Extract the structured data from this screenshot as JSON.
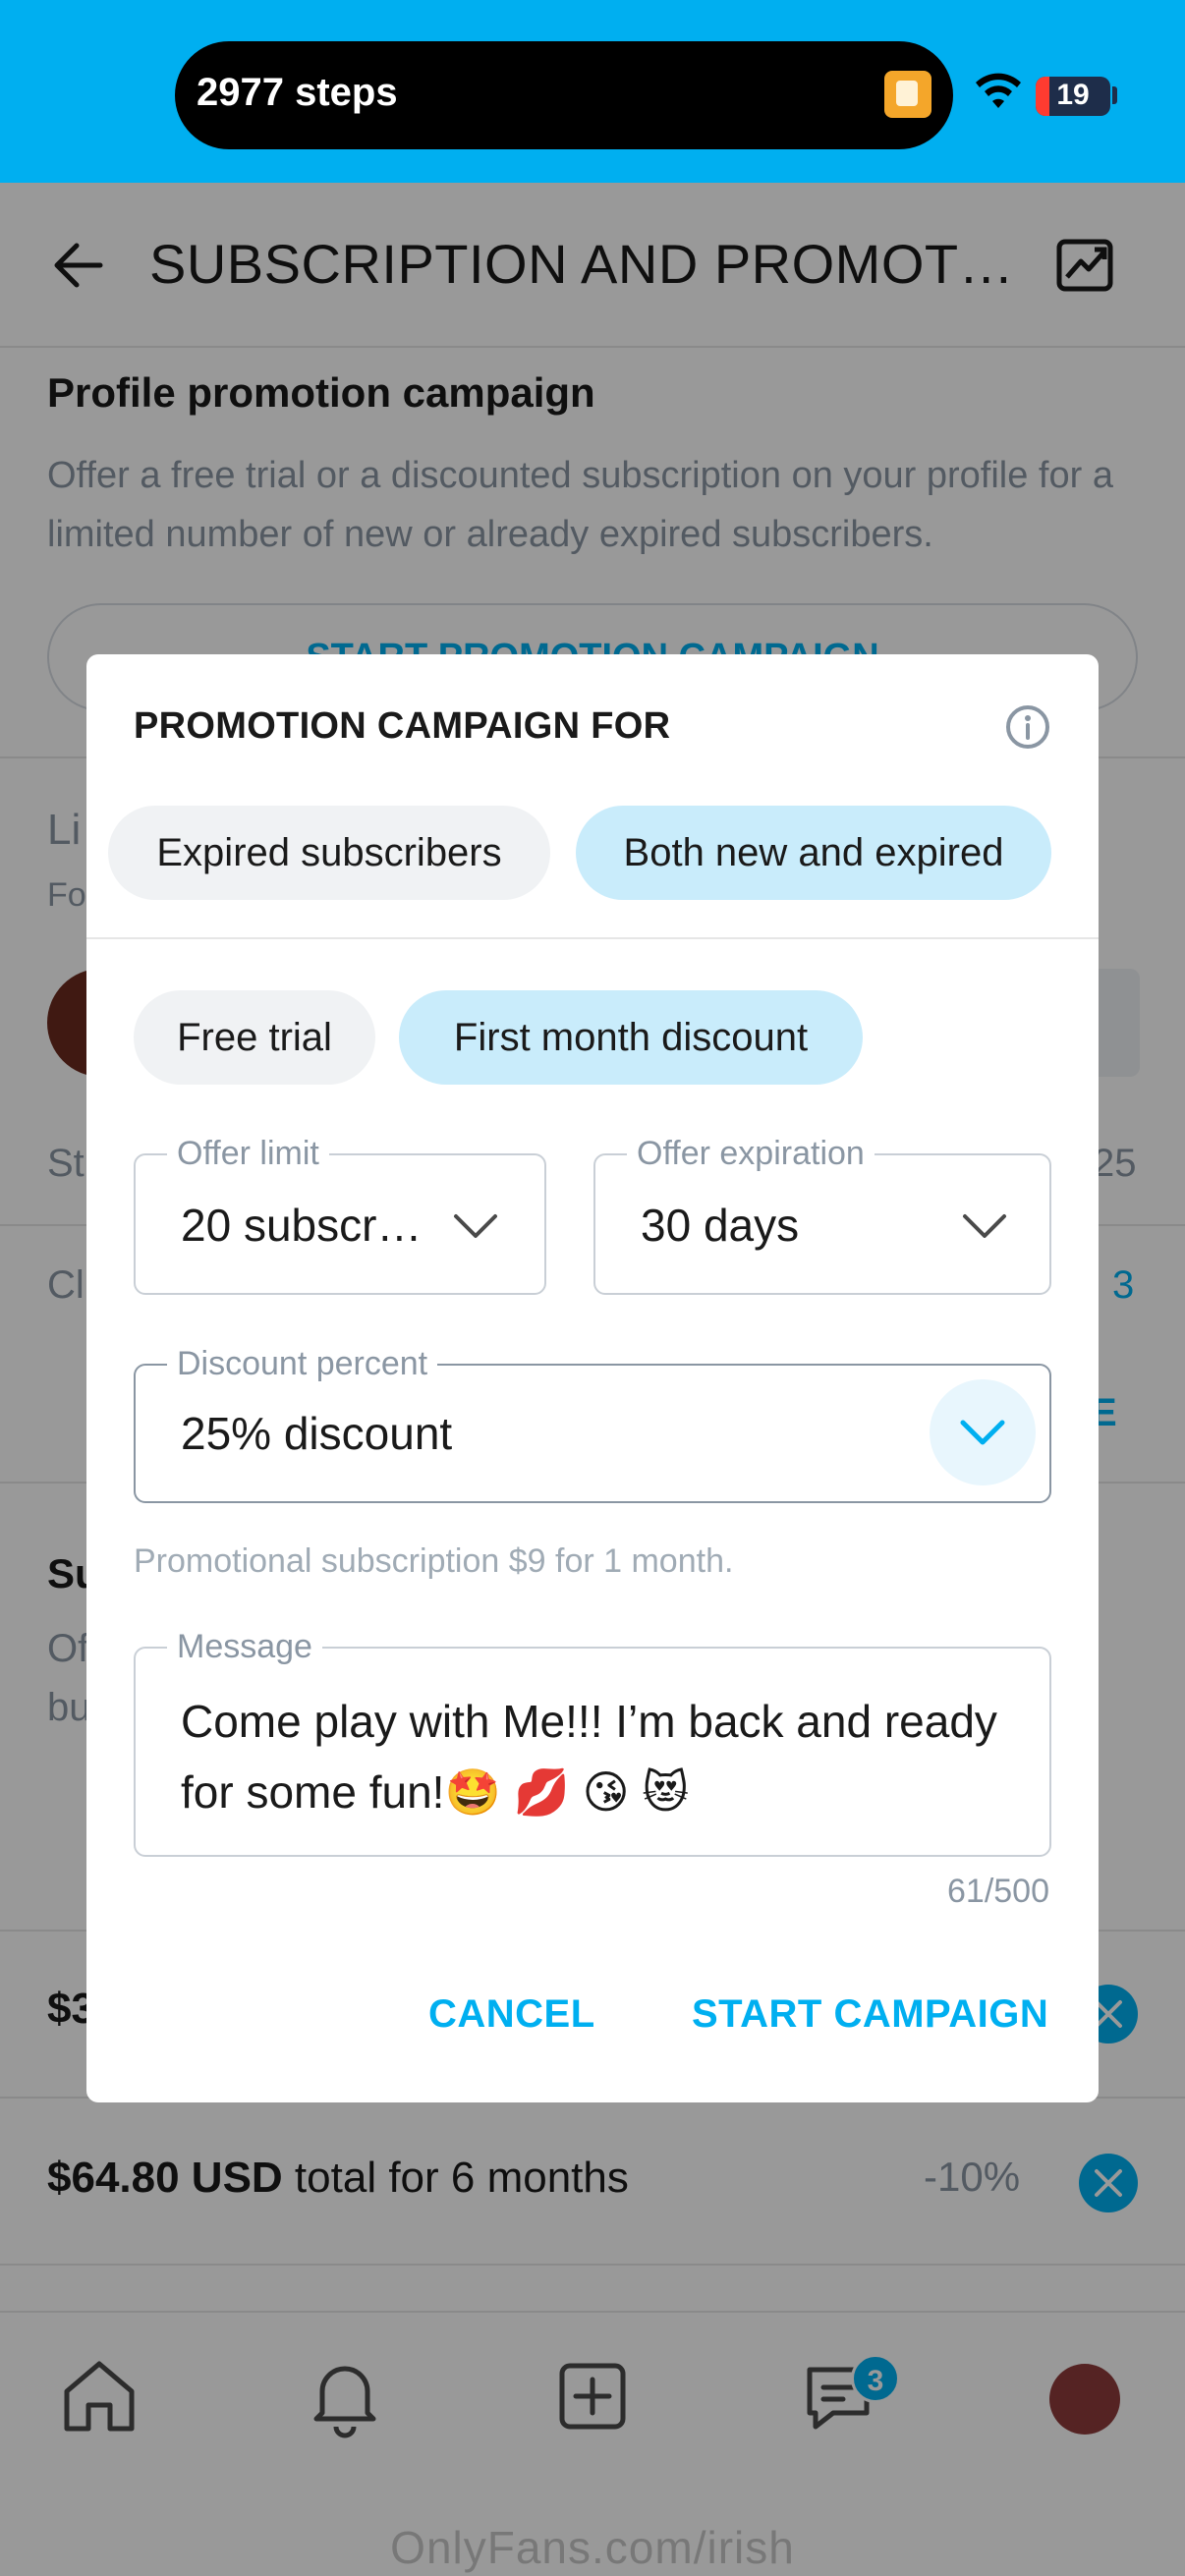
{
  "status_bar": {
    "steps": "2977 steps",
    "battery": "19"
  },
  "header": {
    "title": "SUBSCRIPTION AND PROMOTIO…"
  },
  "promotion_section": {
    "title": "Profile promotion campaign",
    "description": "Offer a free trial or a discounted subscription on your profile for a limited number of new or already expired subscribers.",
    "button": "START PROMOTION CAMPAIGN"
  },
  "background_fragments": {
    "li": "Li",
    "fo": "Fo",
    "st": "St",
    "cl": "Cl",
    "n25": "25",
    "n3": "3",
    "e": "E",
    "su": "Su",
    "of": "Of",
    "bu": "bu",
    "dollar": "$3"
  },
  "bundles": [
    {
      "price": "$64.80 USD",
      "suffix": " total for 6 months",
      "discount": "-10%"
    }
  ],
  "tabbar": {
    "messages_badge": "3"
  },
  "watermark": "OnlyFans.com/irish",
  "dialog": {
    "title": "PROMOTION CAMPAIGN FOR",
    "audience_options": [
      "Expired subscribers",
      "Both new and expired"
    ],
    "audience_selected": "Both new and expired",
    "offer_types": [
      "Free trial",
      "First month discount"
    ],
    "offer_selected": "First month discount",
    "offer_limit": {
      "label": "Offer limit",
      "value": "20 subscr…"
    },
    "offer_expiration": {
      "label": "Offer expiration",
      "value": "30 days"
    },
    "discount_percent": {
      "label": "Discount percent",
      "value": "25% discount"
    },
    "hint": "Promotional subscription $9 for 1 month.",
    "message": {
      "label": "Message",
      "value": "Come play with Me!!! I’m back and ready for some fun!🤩 💋 😘 😻",
      "counter": "61/500"
    },
    "cancel": "CANCEL",
    "start": "START CAMPAIGN"
  },
  "colors": {
    "brand": "#00aff0",
    "selected_pill": "#c9ecfb",
    "pill": "#f0f2f4"
  }
}
